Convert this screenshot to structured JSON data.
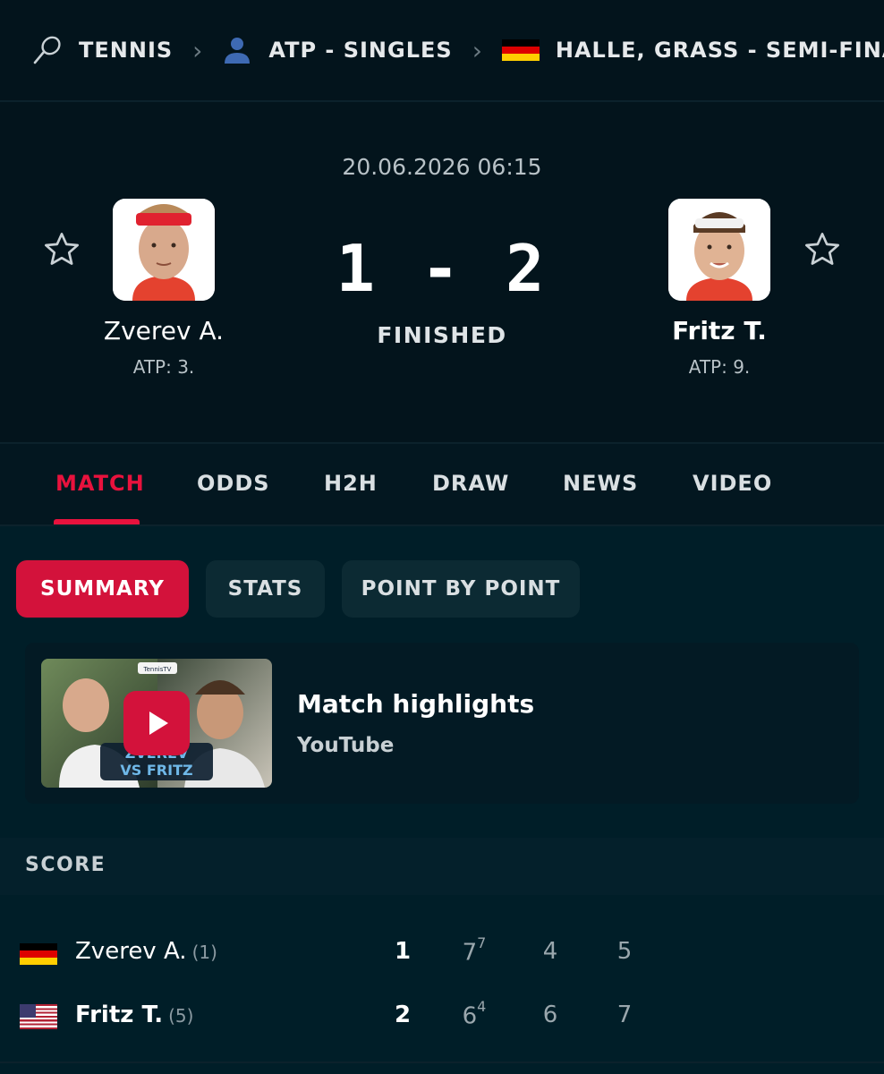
{
  "breadcrumb": {
    "sport": "TENNIS",
    "category": "ATP - SINGLES",
    "tournament": "HALLE, GRASS - SEMI-FINAL"
  },
  "match": {
    "datetime": "20.06.2026 06:15",
    "score": "1 - 2",
    "status": "FINISHED",
    "home": {
      "name": "Zverev A.",
      "rank": "ATP: 3."
    },
    "away": {
      "name": "Fritz T.",
      "rank": "ATP: 9."
    }
  },
  "tabs": [
    "MATCH",
    "ODDS",
    "H2H",
    "DRAW",
    "NEWS",
    "VIDEO"
  ],
  "subtabs": [
    "SUMMARY",
    "STATS",
    "POINT BY POINT"
  ],
  "highlights": {
    "title": "Match highlights",
    "source": "YouTube",
    "thumb_text_1": "ZVEREV",
    "thumb_text_2": "VS FRITZ",
    "thumb_badge": "TennisTV"
  },
  "score_section": {
    "heading": "SCORE",
    "rows": [
      {
        "name": "Zverev A.",
        "seed": "(1)",
        "total": "1",
        "sets": [
          {
            "g": "7",
            "tb": "7"
          },
          {
            "g": "4",
            "tb": ""
          },
          {
            "g": "5",
            "tb": ""
          }
        ]
      },
      {
        "name": "Fritz T.",
        "seed": "(5)",
        "total": "2",
        "sets": [
          {
            "g": "6",
            "tb": "4"
          },
          {
            "g": "6",
            "tb": ""
          },
          {
            "g": "7",
            "tb": ""
          }
        ]
      }
    ]
  },
  "colors": {
    "accent": "#d3123b",
    "background": "#001e28"
  }
}
